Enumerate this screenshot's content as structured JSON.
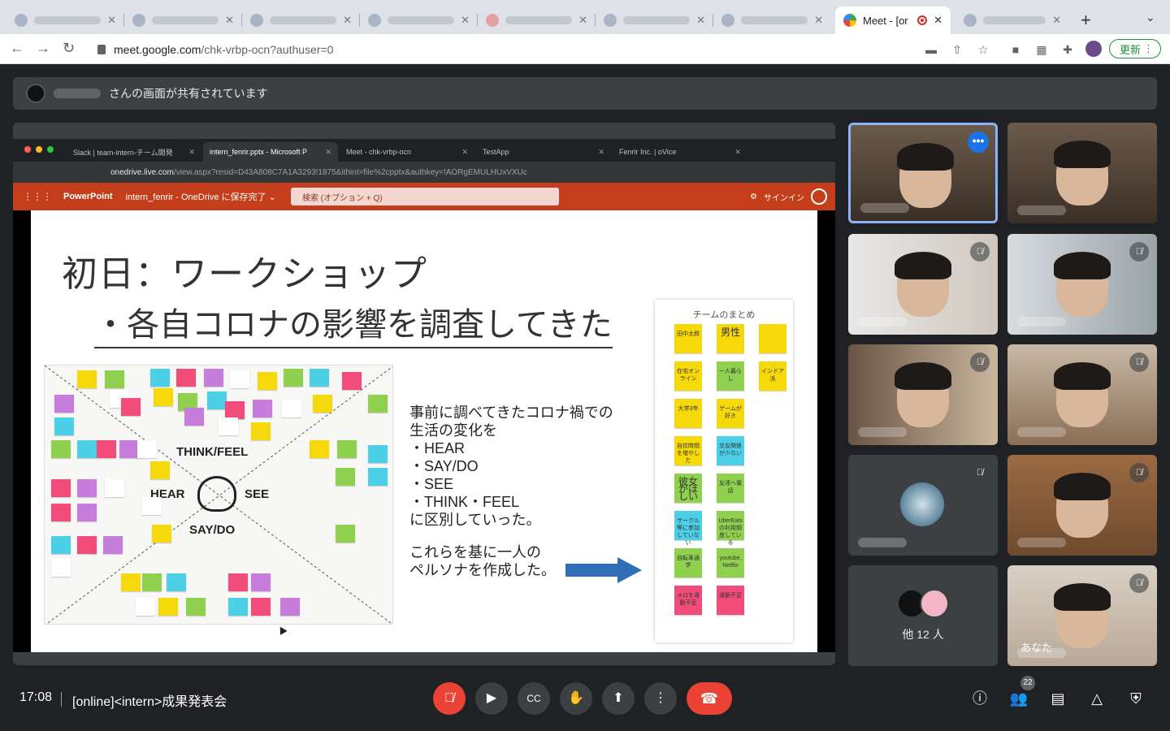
{
  "browser": {
    "active_tab": {
      "title": "Meet - [or",
      "close": "✕"
    },
    "url_host": "meet.google.com",
    "url_path": "/chk-vrbp-ocn?authuser=0",
    "update_label": "更新",
    "new_tab": "+",
    "tab_menu": "⌄"
  },
  "share_banner": {
    "text": "さんの画面が共有されています"
  },
  "presentation": {
    "tabs": [
      {
        "label": "Slack | team-intern-チーム開発"
      },
      {
        "label": "intern_fenrir.pptx - Microsoft P"
      },
      {
        "label": "Meet - chk-vrbp-ocn"
      },
      {
        "label": "TestApp"
      },
      {
        "label": "Fenrir Inc. | oVice"
      }
    ],
    "url_host": "onedrive.live.com",
    "url_path": "/view.aspx?resid=D43A808C7A1A3293!1875&ithint=file%2cpptx&authkey=!AORgEMULHUxVXUc",
    "app_name": "PowerPoint",
    "file_status": "intern_fenrir - OneDrive に保存完了 ⌄",
    "search_placeholder": "検索 (オプション + Q)",
    "signin": "サインイン",
    "slide": {
      "title": "初日：ワークショップ",
      "subtitle": "・各自コロナの影響を調査してきた",
      "board_labels": {
        "think": "THINK/FEEL",
        "hear": "HEAR",
        "see": "SEE",
        "saydo": "SAY/DO"
      },
      "body": "事前に調べてきたコロナ禍での\n生活の変化を\n・HEAR\n・SAY/DO\n・SEE\n・THINK・FEEL\nに区別していった。",
      "body2": "これらを基に一人の\nペルソナを作成した。",
      "team_header": "チームのまとめ",
      "team_notes": [
        {
          "text": "田中太郎",
          "color": "#f5d90a"
        },
        {
          "text": "男性",
          "color": "#f5d90a",
          "big": true
        },
        {
          "text": "",
          "color": "#f5d90a"
        },
        {
          "text": "在宅オンライン",
          "color": "#f5d90a"
        },
        {
          "text": "一人暮らし",
          "color": "#8fd14f"
        },
        {
          "text": "インドア派",
          "color": "#f5d90a"
        },
        {
          "text": "大学3年",
          "color": "#f5d90a"
        },
        {
          "text": "ゲームが好き",
          "color": "#f5d90a"
        },
        {
          "text": "",
          "color": "#ffffff"
        },
        {
          "text": "自炊時間を増やした",
          "color": "#f5d90a"
        },
        {
          "text": "交友関係が少ない",
          "color": "#4bd0e8"
        },
        {
          "text": "",
          "color": "#ffffff"
        },
        {
          "text": "彼女がほしい",
          "color": "#8fd14f",
          "big": true
        },
        {
          "text": "友達へ電話",
          "color": "#8fd14f"
        },
        {
          "text": "",
          "color": "#ffffff"
        },
        {
          "text": "サークル等に参加していない",
          "color": "#4bd0e8"
        },
        {
          "text": "UberEatsの利用頻度している",
          "color": "#8fd14f"
        },
        {
          "text": "",
          "color": "#ffffff"
        },
        {
          "text": "自転車通学",
          "color": "#8fd14f"
        },
        {
          "text": "youtube, Netflix",
          "color": "#8fd14f"
        },
        {
          "text": "",
          "color": "#ffffff"
        },
        {
          "text": "メロを運動不足",
          "color": "#f24d7a"
        },
        {
          "text": "運動不足",
          "color": "#f24d7a"
        },
        {
          "text": "",
          "color": "#ffffff"
        }
      ]
    }
  },
  "participants": [
    {
      "selected": true,
      "more": "•••"
    },
    {},
    {
      "muted": true
    },
    {
      "muted": true
    },
    {
      "muted": true
    },
    {
      "muted": true
    },
    {
      "muted": true,
      "avatar_only": true
    },
    {
      "muted": true
    },
    {
      "others_label": "他 12 人"
    },
    {
      "muted": true,
      "name": "あなた"
    }
  ],
  "footer": {
    "time": "17:08",
    "meeting_title": "[online]<intern>成果発表会",
    "participant_count": "22",
    "icons": [
      "mic-off-icon",
      "camera-icon",
      "captions-icon",
      "raise-hand-icon",
      "present-icon",
      "more-icon",
      "end-call-icon",
      "info-icon",
      "people-icon",
      "chat-icon",
      "activities-icon",
      "host-controls-icon"
    ]
  },
  "colors": {
    "accent": "#1a73e8",
    "danger": "#ea4335",
    "meet_bg": "#202124",
    "ppt_red": "#c43e1c"
  }
}
